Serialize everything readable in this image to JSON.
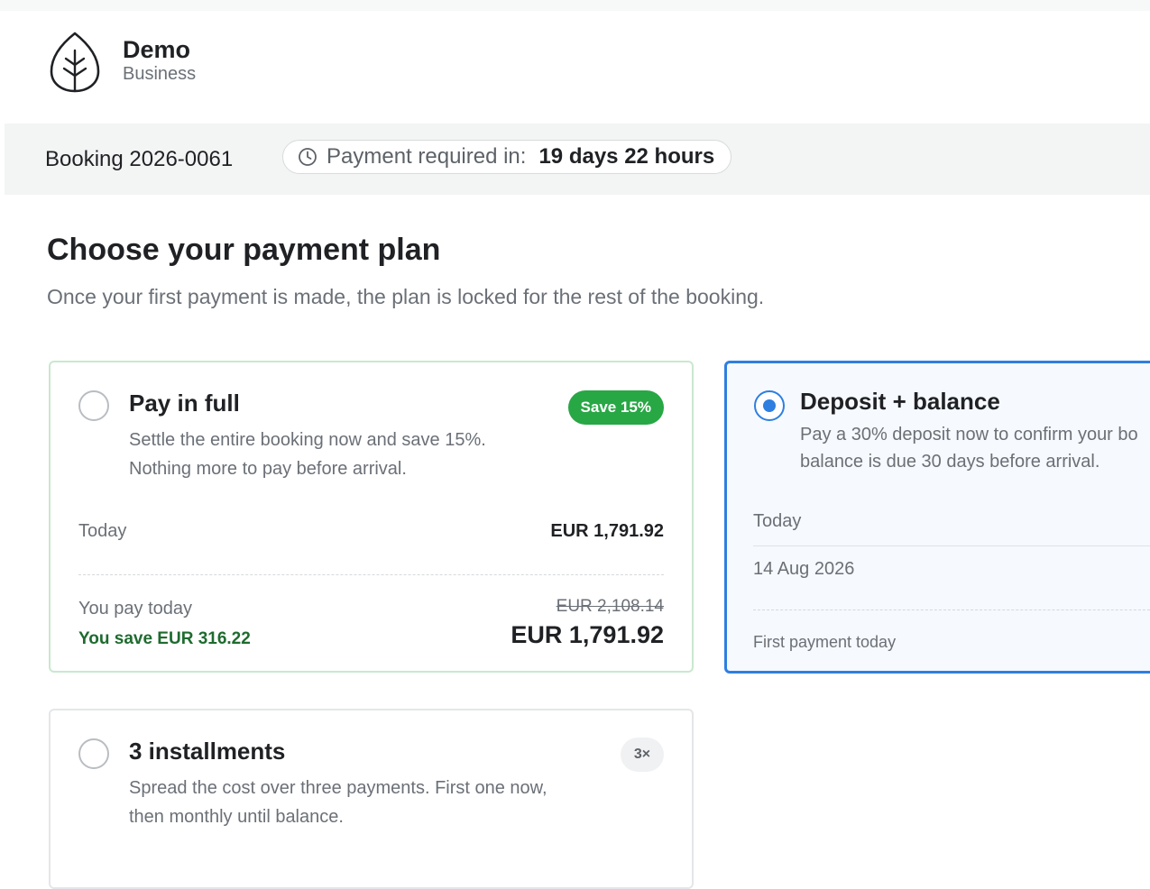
{
  "brand": {
    "name": "Demo",
    "subtitle": "Business",
    "logo_icon": "leaf-icon"
  },
  "booking": {
    "id_label": "Booking 2026-0061",
    "payment_required_label": "Payment required in:",
    "payment_required_value": "19 days 22 hours",
    "clock_icon": "clock-icon"
  },
  "page": {
    "title": "Choose your payment plan",
    "subtitle": "Once your first payment is made, the plan is locked for the rest of the booking."
  },
  "plans": {
    "full": {
      "selected": false,
      "title": "Pay in full",
      "badge": "Save 15%",
      "desc_line1": "Settle the entire booking now and save 15%.",
      "desc_line2": "Nothing more to pay before arrival.",
      "rows": [
        {
          "label": "Today",
          "amount": "EUR 1,791.92"
        }
      ],
      "pay_today_label": "You pay today",
      "save_label": "You save EUR 316.22",
      "original_amount": "EUR 2,108.14",
      "total_amount": "EUR 1,791.92"
    },
    "deposit": {
      "selected": true,
      "title": "Deposit + balance",
      "desc_line1": "Pay a 30% deposit now to confirm your bo",
      "desc_line2": "balance is due 30 days before arrival.",
      "rows": [
        {
          "label": "Today"
        },
        {
          "label": "14 Aug 2026"
        }
      ],
      "first_payment_label": "First payment today"
    },
    "installments": {
      "selected": false,
      "title": "3 installments",
      "badge": "3×",
      "desc_line1": "Spread the cost over three payments. First one now,",
      "desc_line2": "then monthly until balance."
    }
  },
  "colors": {
    "accent": "#2e7fe0",
    "success": "#28a745",
    "success_text": "#1e6b2f",
    "bar_bg": "#f3f4f4"
  }
}
